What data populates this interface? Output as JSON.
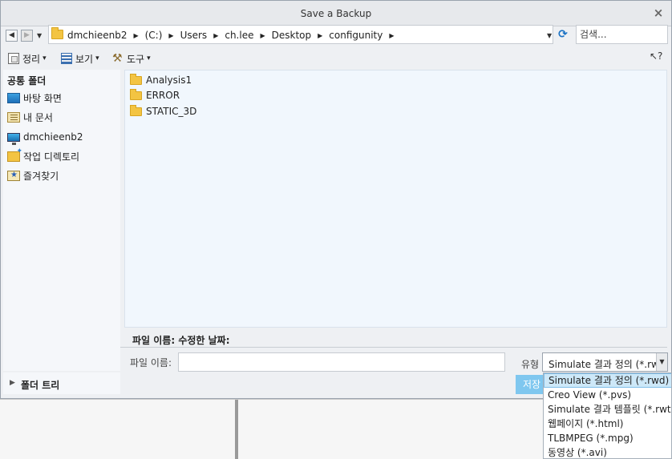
{
  "window": {
    "title": "Save a Backup",
    "close_glyph": "×"
  },
  "nav": {
    "back_glyph": "◀",
    "forward_glyph": "▶",
    "dropdown_glyph": "▼",
    "breadcrumb_sep": "▶",
    "breadcrumbs": [
      "dmchieenb2",
      "(C:)",
      "Users",
      "ch.lee",
      "Desktop",
      "configunity"
    ],
    "address_dropdown_glyph": "▼",
    "refresh_glyph": "⟳",
    "search_placeholder": "검색..."
  },
  "toolbar": {
    "organize_label": "정리",
    "view_label": "보기",
    "tools_label": "도구",
    "caret": "▾",
    "tools_glyph": "⚒",
    "help_glyph": "↖?"
  },
  "sidebar": {
    "header": "공통 폴더",
    "items": [
      {
        "label": "바탕 화면",
        "icon": "desktop-icon"
      },
      {
        "label": "내 문서",
        "icon": "documents-icon"
      },
      {
        "label": "dmchieenb2",
        "icon": "computer-icon"
      },
      {
        "label": "작업 디렉토리",
        "icon": "working-directory-icon"
      },
      {
        "label": "즐겨찾기",
        "icon": "favorites-icon"
      }
    ],
    "folder_tree_label": "폴더 트리",
    "folder_tree_glyph": "▶"
  },
  "files": [
    {
      "name": "Analysis1",
      "icon": "folder-icon"
    },
    {
      "name": "ERROR",
      "icon": "folder-icon"
    },
    {
      "name": "STATIC_3D",
      "icon": "folder-icon"
    }
  ],
  "info": {
    "text": "파일 이름:  수정한 날짜:"
  },
  "form": {
    "filename_label": "파일 이름:",
    "filename_value": "",
    "type_label": "유형",
    "type_selected": "Simulate 결과 정의 (*.rwd)",
    "type_dropdown_glyph": "▼",
    "save_label": "저장"
  },
  "dropdown_options": [
    "Simulate 결과 정의 (*.rwd)",
    "Creo View (*.pvs)",
    "Simulate 결과 템플릿 (*.rwt)",
    "웹페이지 (*.html)",
    "TLBMPEG (*.mpg)",
    "동영상 (*.avi)"
  ],
  "colors": {
    "accent": "#7fc7ef",
    "selection": "#cde8f8",
    "folder": "#f3c442"
  }
}
